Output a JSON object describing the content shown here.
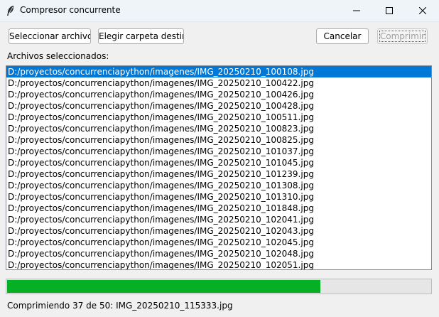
{
  "window": {
    "title": "Compresor concurrente",
    "app_icon": "feather-icon",
    "controls": [
      "minimize-icon",
      "maximize-icon",
      "close-icon"
    ]
  },
  "toolbar": {
    "select_files_label": "Seleccionar archivos",
    "choose_folder_label": "Elegir carpeta destino",
    "cancel_label": "Cancelar",
    "compress_label": "Comprimir"
  },
  "files": {
    "label": "Archivos seleccionados:",
    "selected_index": 0,
    "items": [
      "D:/proyectos/concurrenciapython/imagenes/IMG_20250210_100108.jpg",
      "D:/proyectos/concurrenciapython/imagenes/IMG_20250210_100422.jpg",
      "D:/proyectos/concurrenciapython/imagenes/IMG_20250210_100426.jpg",
      "D:/proyectos/concurrenciapython/imagenes/IMG_20250210_100428.jpg",
      "D:/proyectos/concurrenciapython/imagenes/IMG_20250210_100511.jpg",
      "D:/proyectos/concurrenciapython/imagenes/IMG_20250210_100823.jpg",
      "D:/proyectos/concurrenciapython/imagenes/IMG_20250210_100825.jpg",
      "D:/proyectos/concurrenciapython/imagenes/IMG_20250210_101037.jpg",
      "D:/proyectos/concurrenciapython/imagenes/IMG_20250210_101045.jpg",
      "D:/proyectos/concurrenciapython/imagenes/IMG_20250210_101239.jpg",
      "D:/proyectos/concurrenciapython/imagenes/IMG_20250210_101308.jpg",
      "D:/proyectos/concurrenciapython/imagenes/IMG_20250210_101310.jpg",
      "D:/proyectos/concurrenciapython/imagenes/IMG_20250210_101848.jpg",
      "D:/proyectos/concurrenciapython/imagenes/IMG_20250210_102041.jpg",
      "D:/proyectos/concurrenciapython/imagenes/IMG_20250210_102043.jpg",
      "D:/proyectos/concurrenciapython/imagenes/IMG_20250210_102045.jpg",
      "D:/proyectos/concurrenciapython/imagenes/IMG_20250210_102048.jpg",
      "D:/proyectos/concurrenciapython/imagenes/IMG_20250210_102051.jpg"
    ]
  },
  "progress": {
    "fraction": 0.74,
    "color": "#06b025"
  },
  "status": {
    "text": "Comprimiendo 37 de 50: IMG_20250210_115333.jpg"
  },
  "colors": {
    "selection": "#0078d7",
    "titlebar": "#eff4f9"
  }
}
